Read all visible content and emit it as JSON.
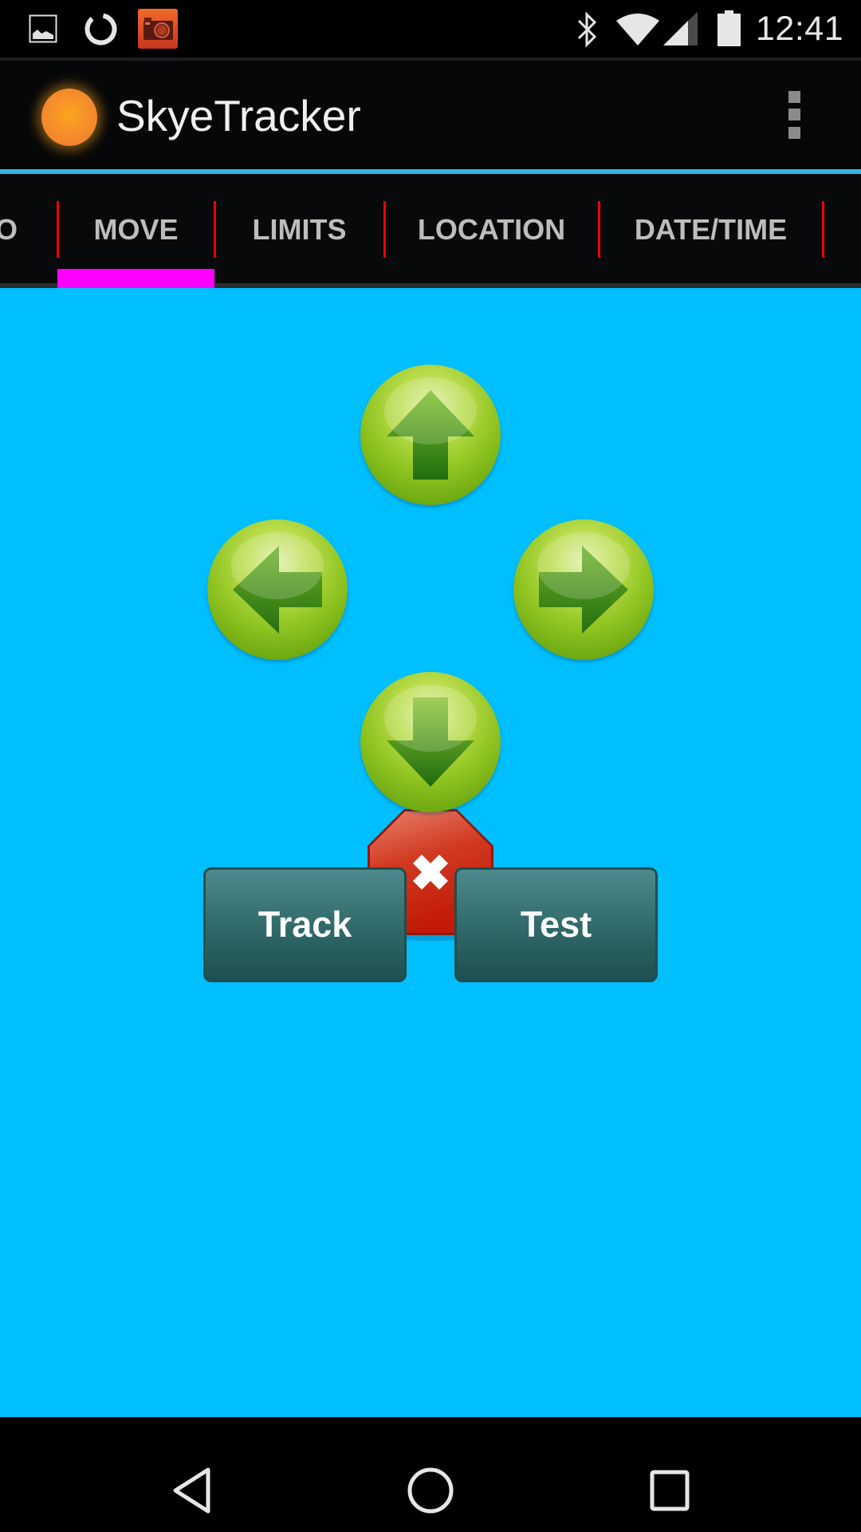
{
  "status_bar": {
    "left_icons": [
      "gallery-image-icon",
      "sync-icon",
      "camera-app-icon"
    ],
    "right_icons": [
      "bluetooth-icon",
      "wifi-icon",
      "cellular-signal-icon",
      "battery-icon"
    ],
    "time": "12:41"
  },
  "app_bar": {
    "title": "SkyeTracker",
    "logo_icon": "orange-sun-icon",
    "overflow_icon": "overflow-menu-icon"
  },
  "tabs": {
    "items": [
      {
        "label": "O",
        "selected": false
      },
      {
        "label": "MOVE",
        "selected": true
      },
      {
        "label": "LIMITS",
        "selected": false
      },
      {
        "label": "LOCATION",
        "selected": false
      },
      {
        "label": "DATE/TIME",
        "selected": false
      }
    ],
    "indicator_color": "#ff00ff",
    "separator_color": "#f00000"
  },
  "move_panel": {
    "dpad": {
      "up_icon": "arrow-up-icon",
      "left_icon": "arrow-left-icon",
      "right_icon": "arrow-right-icon",
      "down_icon": "arrow-down-icon",
      "stop_icon": "stop-x-icon"
    },
    "buttons": {
      "track_label": "Track",
      "test_label": "Test"
    },
    "background_color": "#00bfff"
  },
  "nav_bar": {
    "back_icon": "back-icon",
    "home_icon": "home-icon",
    "recents_icon": "recents-icon"
  }
}
